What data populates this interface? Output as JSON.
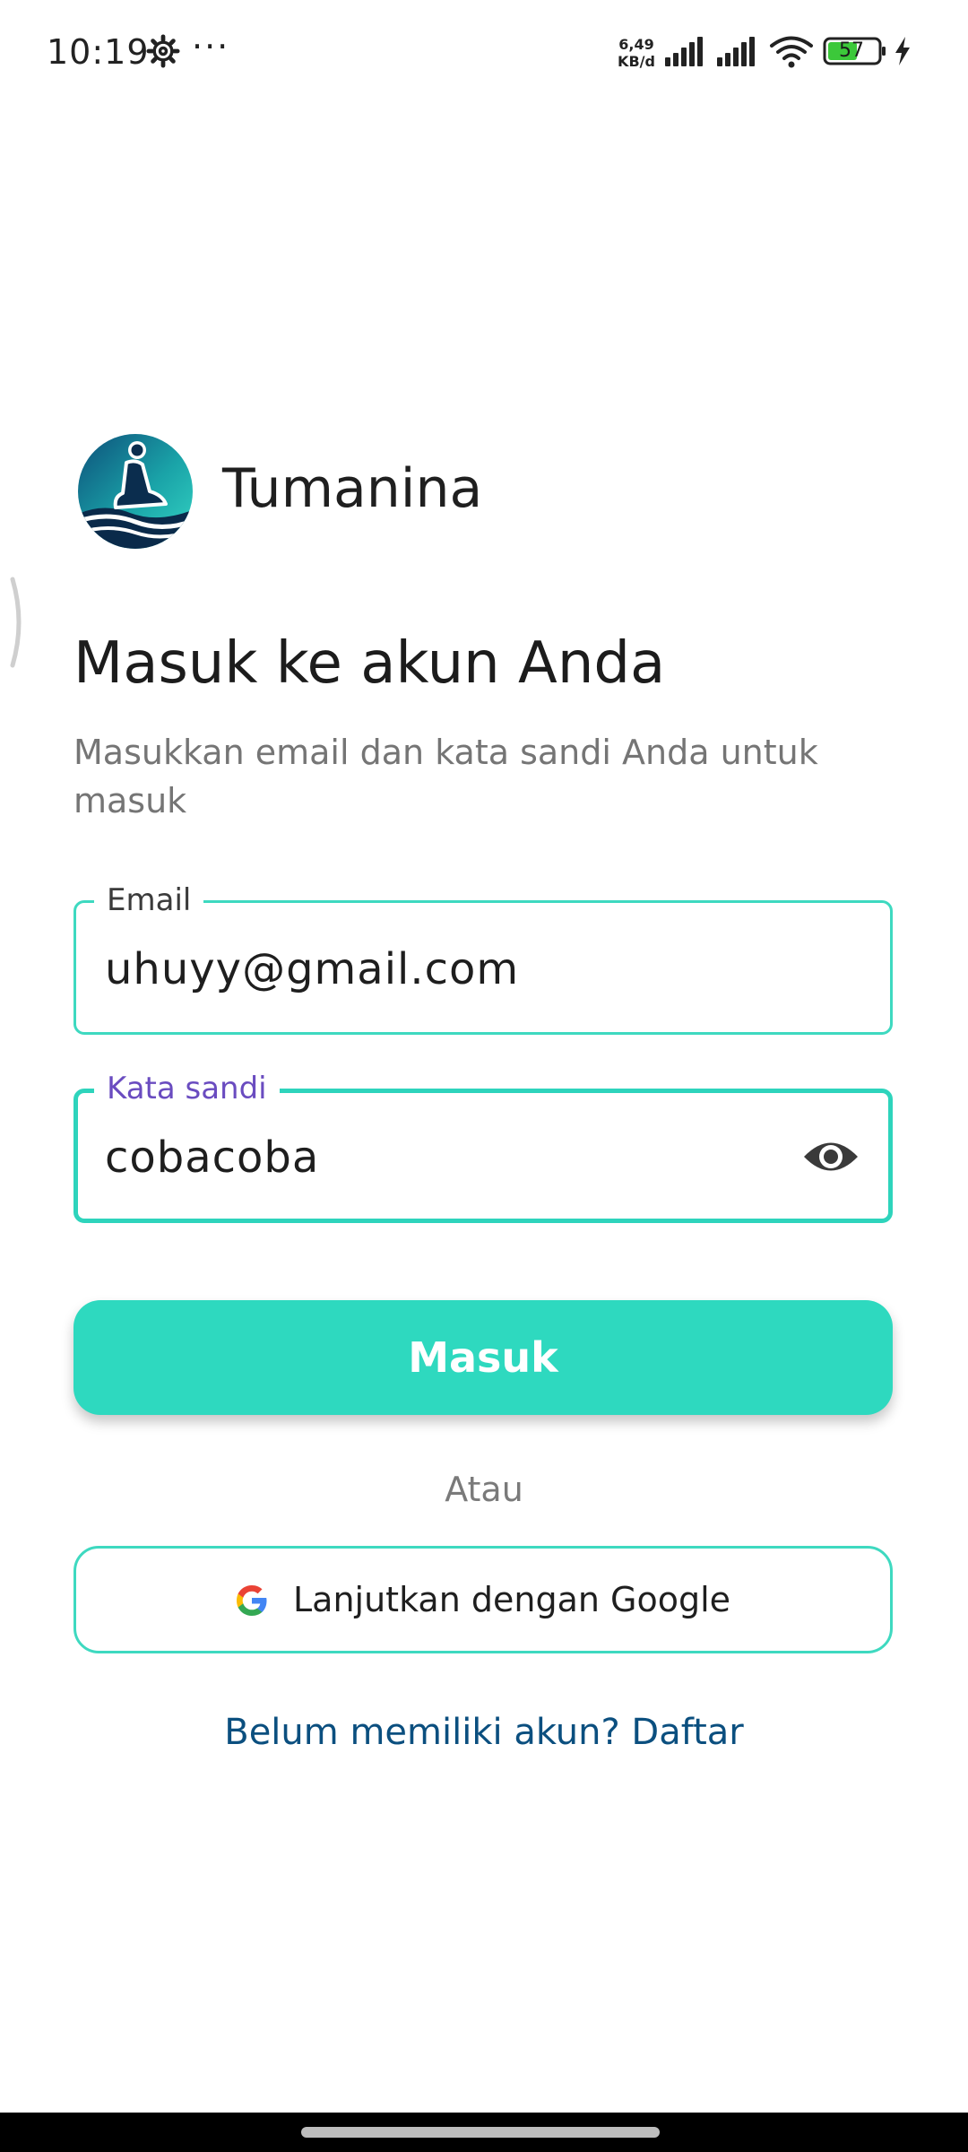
{
  "status_bar": {
    "time": "10:19",
    "speed_value": "6,49",
    "speed_unit": "KB/d",
    "battery_level": "57",
    "icons": [
      "settings-gear-icon",
      "more-dots-icon",
      "signal-icon",
      "signal-icon",
      "wifi-icon",
      "battery-icon",
      "charging-bolt-icon"
    ],
    "more_indicator": "···"
  },
  "brand": {
    "app_name": "Tumanina",
    "logo_icon": "meditation-logo-icon"
  },
  "login": {
    "heading": "Masuk ke akun Anda",
    "subheading": "Masukkan email dan kata sandi Anda untuk masuk",
    "email": {
      "label": "Email",
      "value": "uhuyy@gmail.com"
    },
    "password": {
      "label": "Kata sandi",
      "value": "cobacoba",
      "toggle_icon": "eye-visibility-icon"
    },
    "submit_label": "Masuk",
    "separator": "Atau",
    "google_label": "Lanjutkan dengan Google",
    "register_prompt": "Belum memiliki akun? Daftar"
  },
  "colors": {
    "accent": "#2ed9bf",
    "field_border": "#3ed9c0",
    "focused_label": "#6a4cc0",
    "link": "#0b4f7f",
    "text_primary": "#1c1c1c",
    "text_secondary": "#757575"
  }
}
